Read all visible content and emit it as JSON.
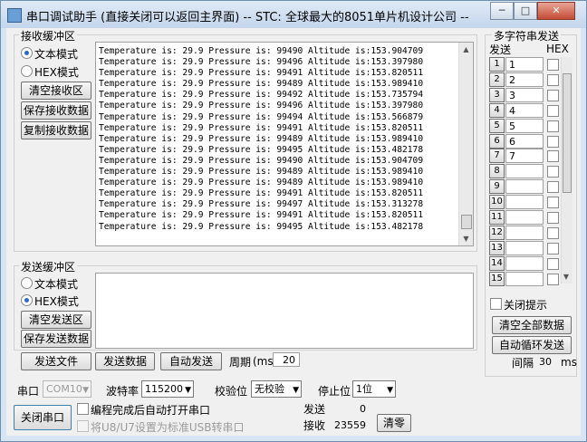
{
  "window": {
    "title": "串口调试助手 (直接关闭可以返回主界面) -- STC: 全球最大的8051单片机设计公司 --",
    "min_label": "─",
    "max_label": "□",
    "close_label": "✕"
  },
  "receive": {
    "group_label": "接收缓冲区",
    "text_mode": "文本模式",
    "hex_mode": "HEX模式",
    "clear_button": "清空接收区",
    "save_button": "保存接收数据",
    "copy_button": "复制接收数据",
    "lines": [
      "Temperature is: 29.9 Pressure is: 99490 Altitude is:153.904709",
      "Temperature is: 29.9 Pressure is: 99496 Altitude is:153.397980",
      "Temperature is: 29.9 Pressure is: 99491 Altitude is:153.820511",
      "Temperature is: 29.9 Pressure is: 99489 Altitude is:153.989410",
      "Temperature is: 29.9 Pressure is: 99492 Altitude is:153.735794",
      "Temperature is: 29.9 Pressure is: 99496 Altitude is:153.397980",
      "Temperature is: 29.9 Pressure is: 99494 Altitude is:153.566879",
      "Temperature is: 29.9 Pressure is: 99491 Altitude is:153.820511",
      "Temperature is: 29.9 Pressure is: 99489 Altitude is:153.989410",
      "Temperature is: 29.9 Pressure is: 99495 Altitude is:153.482178",
      "Temperature is: 29.9 Pressure is: 99490 Altitude is:153.904709",
      "Temperature is: 29.9 Pressure is: 99489 Altitude is:153.989410",
      "Temperature is: 29.9 Pressure is: 99489 Altitude is:153.989410",
      "Temperature is: 29.9 Pressure is: 99491 Altitude is:153.820511",
      "Temperature is: 29.9 Pressure is: 99497 Altitude is:153.313278",
      "Temperature is: 29.9 Pressure is: 99491 Altitude is:153.820511",
      "Temperature is: 29.9 Pressure is: 99495 Altitude is:153.482178"
    ]
  },
  "send": {
    "group_label": "发送缓冲区",
    "text_mode": "文本模式",
    "hex_mode": "HEX模式",
    "clear_button": "清空发送区",
    "save_button": "保存发送数据",
    "send_file_button": "发送文件",
    "send_data_button": "发送数据",
    "auto_send_button": "自动发送",
    "period_label": "周期",
    "period_unit": "(ms)",
    "period_value": "20"
  },
  "multi": {
    "group_label": "多字符串发送",
    "col_send": "发送",
    "col_hex": "HEX",
    "rows": [
      {
        "num": "1",
        "value": "1"
      },
      {
        "num": "2",
        "value": "2"
      },
      {
        "num": "3",
        "value": "3"
      },
      {
        "num": "4",
        "value": "4"
      },
      {
        "num": "5",
        "value": "5"
      },
      {
        "num": "6",
        "value": "6"
      },
      {
        "num": "7",
        "value": "7"
      },
      {
        "num": "8",
        "value": ""
      },
      {
        "num": "9",
        "value": ""
      },
      {
        "num": "10",
        "value": ""
      },
      {
        "num": "11",
        "value": ""
      },
      {
        "num": "12",
        "value": ""
      },
      {
        "num": "13",
        "value": ""
      },
      {
        "num": "14",
        "value": ""
      },
      {
        "num": "15",
        "value": ""
      }
    ],
    "close_tip": "关闭提示",
    "clear_all_button": "清空全部数据",
    "auto_loop_button": "自动循环发送",
    "interval_label": "间隔",
    "interval_value": "30",
    "interval_unit": "ms"
  },
  "bottom": {
    "port_label": "串口",
    "port_value": "COM10",
    "baud_label": "波特率",
    "baud_value": "115200",
    "parity_label": "校验位",
    "parity_value": "无校验",
    "stop_label": "停止位",
    "stop_value": "1位",
    "close_port_button": "关闭串口",
    "auto_open_label": "编程完成后自动打开串口",
    "usb_label": "将U8/U7设置为标准USB转串口",
    "sent_label": "发送",
    "sent_value": "0",
    "recv_label": "接收",
    "recv_value": "23559",
    "clear_count_button": "清零"
  }
}
